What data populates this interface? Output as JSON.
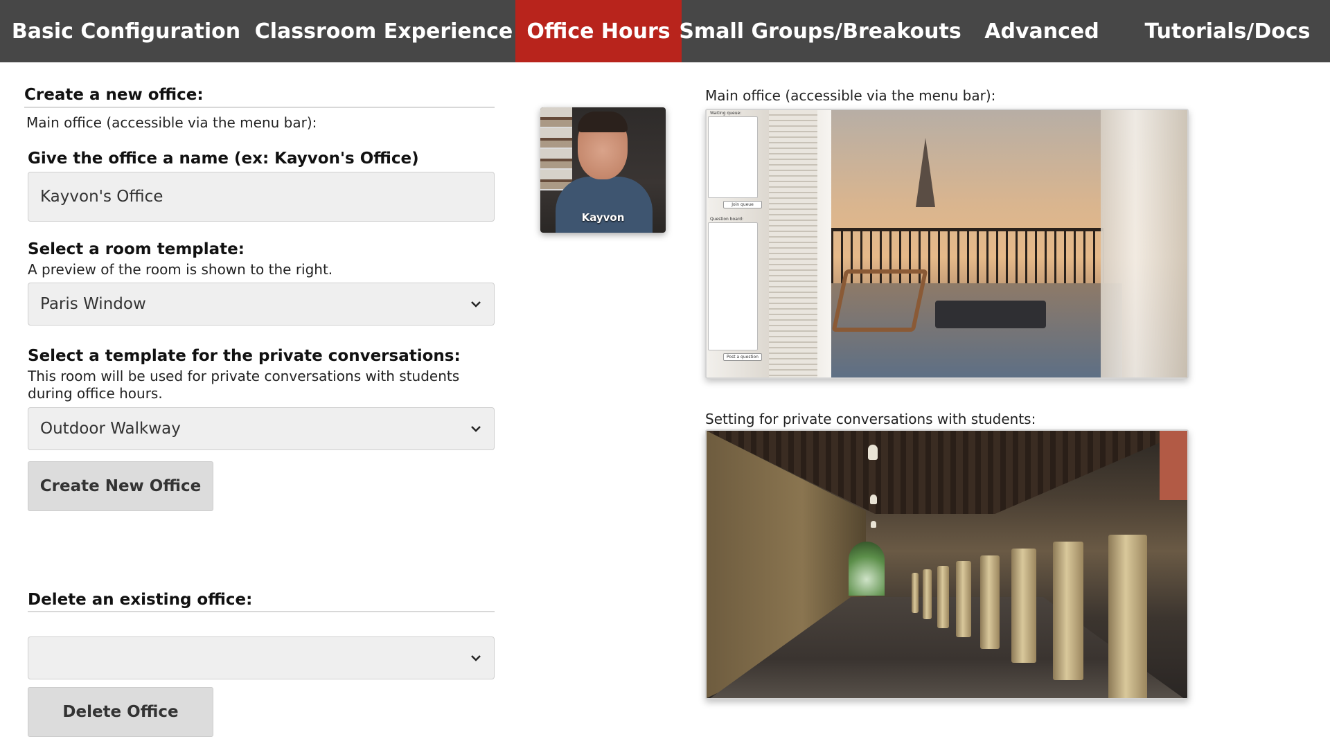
{
  "nav": {
    "tabs": [
      {
        "label": "Basic Configuration"
      },
      {
        "label": "Classroom Experience"
      },
      {
        "label": "Office Hours"
      },
      {
        "label": "Small Groups/Breakouts"
      },
      {
        "label": "Advanced"
      },
      {
        "label": "Tutorials/Docs"
      }
    ],
    "active_index": 2,
    "colors": {
      "bar": "#474747",
      "active": "#b8241c",
      "text": "#ffffff"
    }
  },
  "create": {
    "heading": "Create a new office:",
    "subtext": "Main office (accessible via the menu bar):",
    "name_label": "Give the office a name (ex: Kayvon's Office)",
    "name_value": "Kayvon's Office",
    "room_label": "Select a room template:",
    "room_help": "A preview of the room is shown to the right.",
    "room_selected": "Paris Window",
    "private_label": "Select a template for the private conversations:",
    "private_help_line1": "This room will be used for private conversations with students",
    "private_help_line2": "during office hours.",
    "private_selected": "Outdoor Walkway",
    "create_button": "Create New Office"
  },
  "delete": {
    "heading": "Delete an existing office:",
    "selected": "",
    "delete_button": "Delete Office"
  },
  "video": {
    "name": "Kayvon"
  },
  "previews": {
    "main_caption": "Main office (accessible via the menu bar):",
    "private_caption": "Setting for private conversations with students:",
    "paris_panel1_label": "Waiting queue:",
    "paris_button1": "Join queue",
    "paris_panel2_label": "Question board:",
    "paris_button2": "Post a question"
  },
  "icons": {
    "select_arrow": "chevron-down-icon"
  }
}
